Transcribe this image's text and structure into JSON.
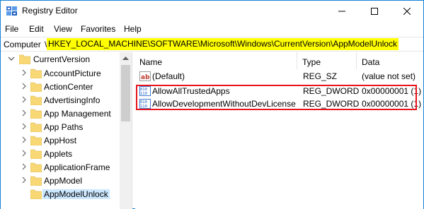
{
  "window": {
    "title": "Registry Editor"
  },
  "menu": [
    "File",
    "Edit",
    "View",
    "Favorites",
    "Help"
  ],
  "address": {
    "root": "Computer",
    "path": "HKEY_LOCAL_MACHINE\\SOFTWARE\\Microsoft\\Windows\\CurrentVersion\\AppModelUnlock"
  },
  "tree": {
    "parent": "CurrentVersion",
    "items": [
      "AccountPicture",
      "ActionCenter",
      "AdvertisingInfo",
      "App Management",
      "App Paths",
      "AppHost",
      "Applets",
      "ApplicationFrame",
      "AppModel",
      "AppModelUnlock"
    ],
    "selected": "AppModelUnlock"
  },
  "list": {
    "columns": [
      "Name",
      "Type",
      "Data"
    ],
    "rows": [
      {
        "icon": "string-value-icon",
        "name": "(Default)",
        "type": "REG_SZ",
        "data": "(value not set)"
      },
      {
        "icon": "dword-value-icon",
        "name": "AllowAllTrustedApps",
        "type": "REG_DWORD",
        "data": "0x00000001 (1)"
      },
      {
        "icon": "dword-value-icon",
        "name": "AllowDevelopmentWithoutDevLicense",
        "type": "REG_DWORD",
        "data": "0x00000001 (1)"
      }
    ]
  },
  "colors": {
    "window_border": "#1883d7",
    "address_highlight": "#ffff00",
    "selection": "#cce8ff",
    "annotation_box": "#e8141c",
    "folder": "#f8d775"
  }
}
